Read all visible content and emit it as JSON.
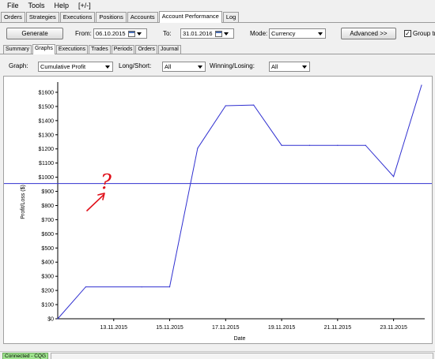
{
  "menu": [
    "File",
    "Tools",
    "Help",
    "[+/-]"
  ],
  "main_tabs": [
    "Orders",
    "Strategies",
    "Executions",
    "Positions",
    "Accounts",
    "Account Performance",
    "Log"
  ],
  "toolbar": {
    "generate_label": "Generate",
    "from_label": "From:",
    "from_value": "06.10.2015",
    "to_label": "To:",
    "to_value": "31.01.2016",
    "mode_label": "Mode:",
    "mode_value": "Currency",
    "advanced_label": "Advanced >>",
    "group_label": "Group tr"
  },
  "sub_tabs": [
    "Summary",
    "Graphs",
    "Executions",
    "Trades",
    "Periods",
    "Orders",
    "Journal"
  ],
  "filters": {
    "graph_label": "Graph:",
    "graph_value": "Cumulative Profit",
    "long_short_label": "Long/Short:",
    "long_short_value": "All",
    "win_lose_label": "Winning/Losing:",
    "win_lose_value": "All"
  },
  "annotation": {
    "text": "?",
    "color": "#e0101a"
  },
  "chart_data": {
    "type": "line",
    "xlabel": "Date",
    "ylabel": "Profit/Loss ($)",
    "ylim": [
      0,
      1650
    ],
    "yticks": [
      0,
      100,
      200,
      300,
      400,
      500,
      600,
      700,
      800,
      900,
      1000,
      1100,
      1200,
      1300,
      1400,
      1500,
      1600
    ],
    "ytick_labels": [
      "$0",
      "$100",
      "$200",
      "$300",
      "$400",
      "$500",
      "$600",
      "$700",
      "$800",
      "$900",
      "$1000",
      "$1100",
      "$1200",
      "$1300",
      "$1400",
      "$1500",
      "$1600"
    ],
    "xlim": [
      "2015-11-11",
      "2015-11-24"
    ],
    "xticks": [
      "2015-11-13",
      "2015-11-15",
      "2015-11-17",
      "2015-11-19",
      "2015-11-21",
      "2015-11-23"
    ],
    "xtick_labels": [
      "13.11.2015",
      "15.11.2015",
      "17.11.2015",
      "19.11.2015",
      "21.11.2015",
      "23.11.2015"
    ],
    "grid": false,
    "series": [
      {
        "color": "#3030d0",
        "x": [
          "2015-11-11",
          "2015-11-12",
          "2015-11-14",
          "2015-11-15",
          "2015-11-16",
          "2015-11-17",
          "2015-11-18",
          "2015-11-19",
          "2015-11-20",
          "2015-11-21",
          "2015-11-22",
          "2015-11-23",
          "2015-11-24"
        ],
        "y": [
          0,
          225,
          225,
          225,
          1205,
          1505,
          1510,
          1225,
          1225,
          1225,
          1225,
          1005,
          1650
        ]
      }
    ],
    "hline": {
      "y": 955,
      "color": "#3030d0"
    }
  },
  "status": {
    "connection": "Connected - CQG"
  }
}
